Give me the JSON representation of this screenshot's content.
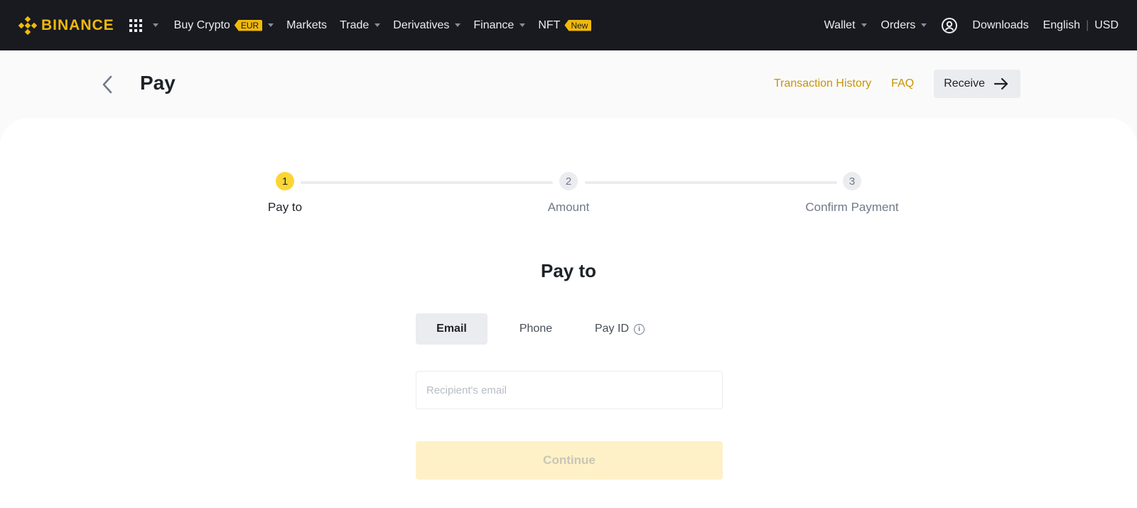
{
  "nav": {
    "logo_text": "BINANCE",
    "items": [
      {
        "label": "Buy Crypto",
        "badge": "EUR",
        "caret": true
      },
      {
        "label": "Markets",
        "caret": false
      },
      {
        "label": "Trade",
        "caret": true
      },
      {
        "label": "Derivatives",
        "caret": true
      },
      {
        "label": "Finance",
        "caret": true
      },
      {
        "label": "NFT",
        "badge": "New",
        "caret": false
      }
    ],
    "right": {
      "wallet": "Wallet",
      "orders": "Orders",
      "downloads": "Downloads",
      "language": "English",
      "currency": "USD"
    }
  },
  "header": {
    "title": "Pay",
    "transaction_history": "Transaction History",
    "faq": "FAQ",
    "receive": "Receive"
  },
  "stepper": {
    "steps": [
      {
        "num": "1",
        "label": "Pay to",
        "active": true
      },
      {
        "num": "2",
        "label": "Amount",
        "active": false
      },
      {
        "num": "3",
        "label": "Confirm Payment",
        "active": false
      }
    ]
  },
  "form": {
    "title": "Pay to",
    "tabs": [
      "Email",
      "Phone",
      "Pay ID"
    ],
    "active_tab": "Email",
    "email_placeholder": "Recipient's email",
    "email_value": "",
    "continue_label": "Continue"
  },
  "colors": {
    "brand": "#f0b90b",
    "nav_bg": "#181a20",
    "link_gold": "#c99400",
    "step_active": "#fcd535",
    "continue_disabled": "#fef1c8"
  }
}
